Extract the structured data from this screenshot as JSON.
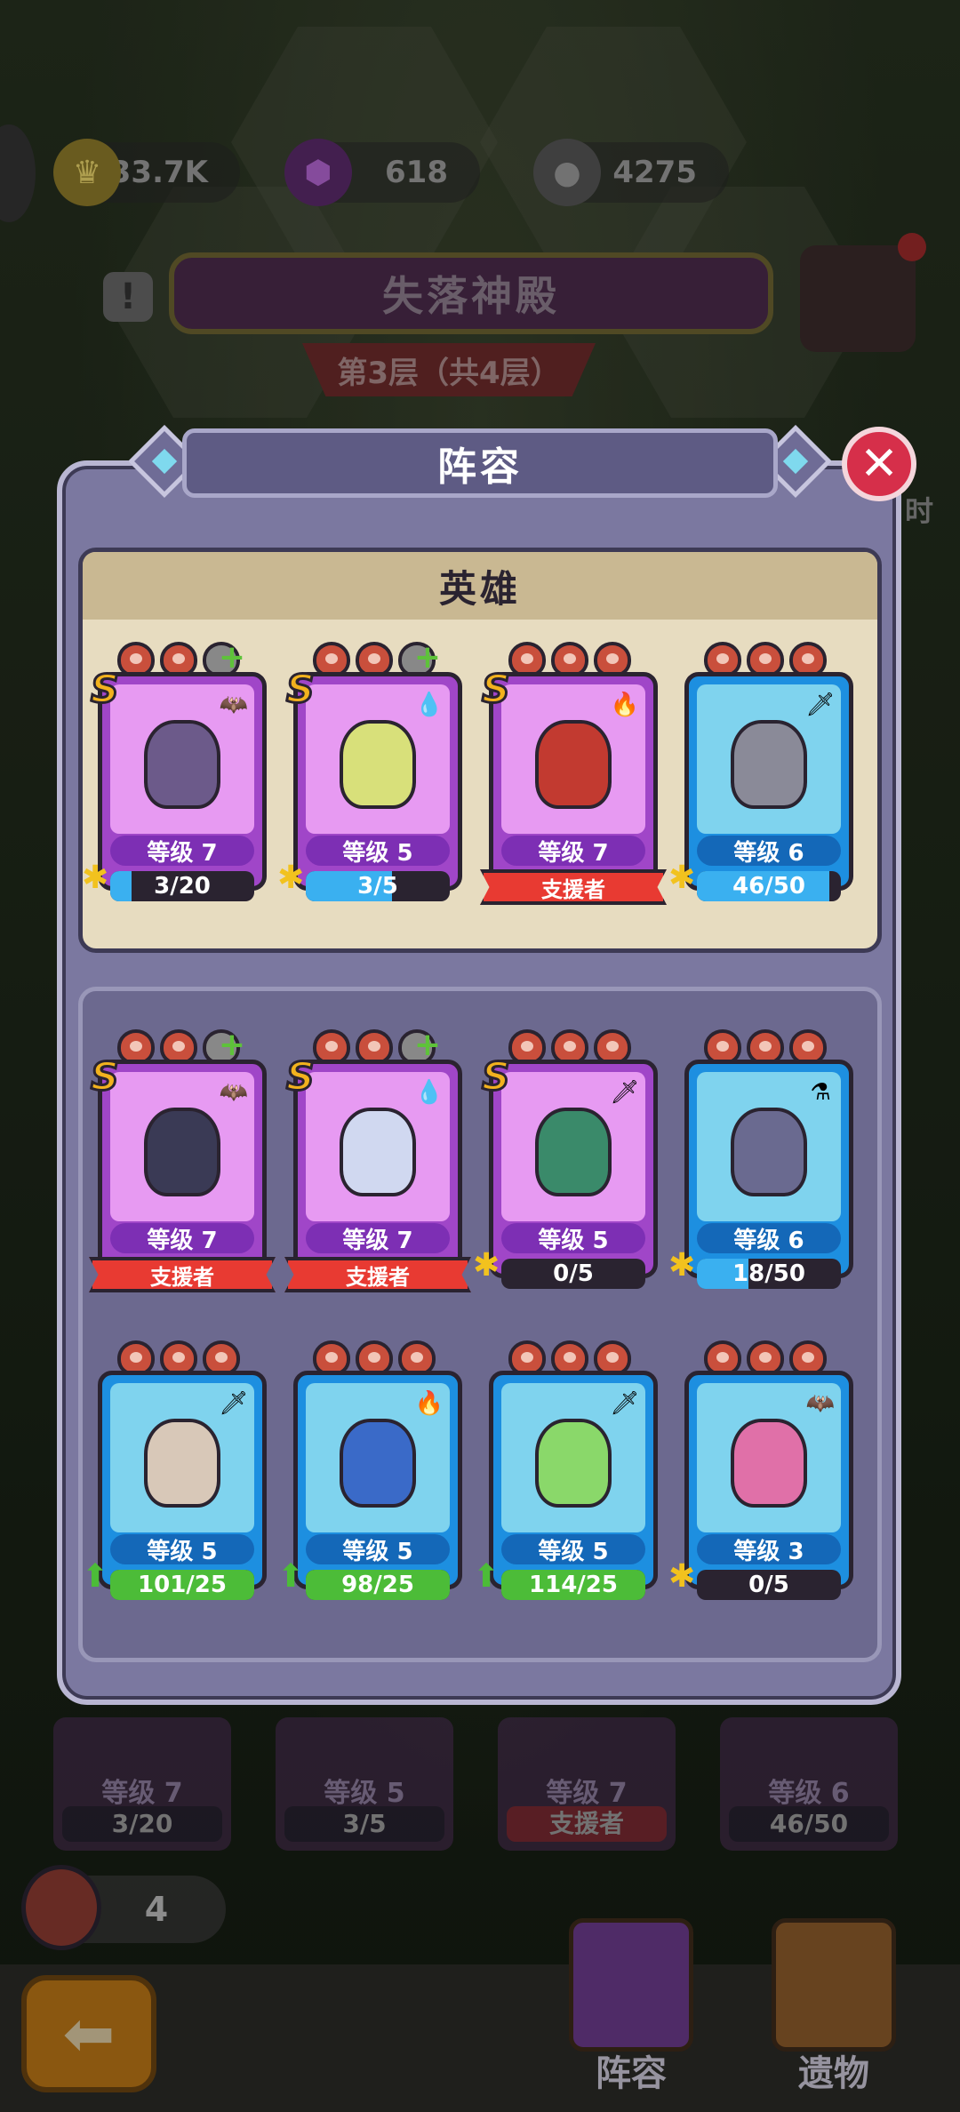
{
  "resources": {
    "crowns": "33.7K",
    "gems": "618",
    "coins": "4275"
  },
  "stage": {
    "title": "失落神殿",
    "floor": "第3层（共4层）",
    "side_label": "时"
  },
  "modal": {
    "title": "阵容",
    "close_glyph": "✕",
    "heroes_header": "英雄"
  },
  "team": [
    {
      "rarity": "S",
      "level": "等级 7",
      "progress": "3/20",
      "progress_fraction": 0.15,
      "element": "bat-icon",
      "frame": "purple",
      "meat": [
        "meat",
        "meat",
        "plus"
      ]
    },
    {
      "rarity": "S",
      "level": "等级 5",
      "progress": "3/5",
      "progress_fraction": 0.6,
      "element": "water-drop-icon",
      "frame": "purple",
      "meat": [
        "meat",
        "meat",
        "plus"
      ]
    },
    {
      "rarity": "S",
      "level": "等级 7",
      "support": "支援者",
      "element": "fire-icon",
      "frame": "purple",
      "meat": [
        "meat",
        "meat",
        "meat"
      ]
    },
    {
      "rarity": "",
      "level": "等级 6",
      "progress": "46/50",
      "progress_fraction": 0.92,
      "element": "sword-icon",
      "frame": "blue",
      "meat": [
        "meat",
        "meat",
        "meat"
      ]
    }
  ],
  "roster": [
    {
      "rarity": "S",
      "level": "等级 7",
      "support": "支援者",
      "element": "bat-icon",
      "frame": "purple",
      "meat": [
        "meat",
        "meat",
        "plus"
      ]
    },
    {
      "rarity": "S",
      "level": "等级 7",
      "support": "支援者",
      "element": "water-drop-icon",
      "frame": "purple",
      "meat": [
        "meat",
        "meat",
        "plus"
      ]
    },
    {
      "rarity": "S",
      "level": "等级 5",
      "progress": "0/5",
      "progress_fraction": 0,
      "element": "sword-icon",
      "frame": "purple",
      "meat": [
        "meat",
        "meat",
        "meat"
      ]
    },
    {
      "rarity": "",
      "level": "等级 6",
      "progress": "18/50",
      "progress_fraction": 0.36,
      "element": "potion-icon",
      "frame": "blue",
      "meat": [
        "meat",
        "meat",
        "meat"
      ]
    },
    {
      "rarity": "",
      "level": "等级 5",
      "progress": "101/25",
      "progress_fraction": 1,
      "upgrade": true,
      "element": "sword-icon",
      "frame": "blue",
      "meat": [
        "meat",
        "meat",
        "meat"
      ]
    },
    {
      "rarity": "",
      "level": "等级 5",
      "progress": "98/25",
      "progress_fraction": 1,
      "upgrade": true,
      "element": "fire-icon",
      "frame": "blue",
      "meat": [
        "meat",
        "meat",
        "meat"
      ]
    },
    {
      "rarity": "",
      "level": "等级 5",
      "progress": "114/25",
      "progress_fraction": 1,
      "upgrade": true,
      "element": "sword-icon",
      "frame": "blue",
      "meat": [
        "meat",
        "meat",
        "meat"
      ]
    },
    {
      "rarity": "",
      "level": "等级 3",
      "progress": "0/5",
      "progress_fraction": 0,
      "element": "bat-icon",
      "frame": "blue",
      "meat": [
        "meat",
        "meat",
        "meat"
      ]
    }
  ],
  "background_cards": [
    {
      "level": "等级 7",
      "progress": "3/20"
    },
    {
      "level": "等级 5",
      "progress": "3/5"
    },
    {
      "level": "等级 7",
      "support": "支援者"
    },
    {
      "level": "等级 6",
      "progress": "46/50"
    }
  ],
  "meat_count": "4",
  "nav": {
    "back_glyph": "⬅",
    "lineup": "阵容",
    "relics": "遗物"
  },
  "colors": {
    "purple_frame": "#a046c8",
    "blue_frame": "#1d8fe0",
    "support_red": "#e83a32",
    "progress_blue": "#3ab0f0",
    "progress_green": "#4cbc38"
  }
}
